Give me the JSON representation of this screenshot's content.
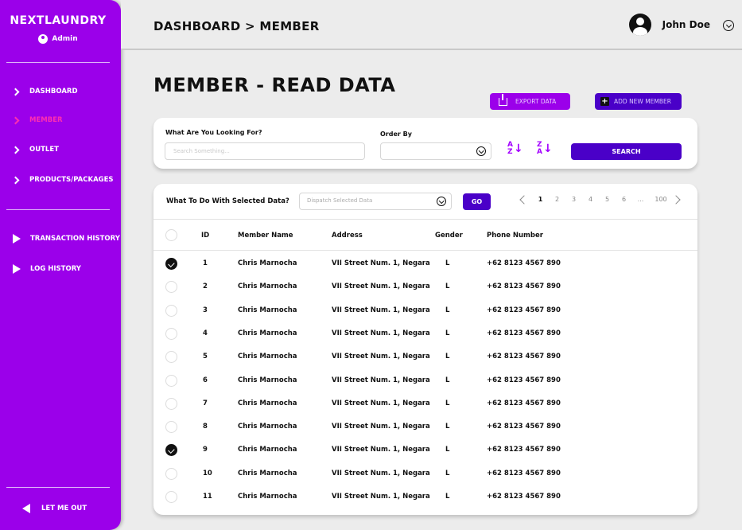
{
  "sidebar": {
    "brand": "NEXTLAUNDRY",
    "role": "Admin",
    "items": [
      {
        "label": "DASHBOARD"
      },
      {
        "label": "MEMBER"
      },
      {
        "label": "OUTLET"
      },
      {
        "label": "PRODUCTS/PACKAGES"
      }
    ],
    "history_items": [
      {
        "label": "TRANSACTION HISTORY"
      },
      {
        "label": "LOG HISTORY"
      }
    ],
    "logout": "LET ME OUT",
    "colors": {
      "background": "#9b00ea",
      "active": "#ff2fb0"
    }
  },
  "header": {
    "breadcrumb": "DASHBOARD > MEMBER",
    "user_name": "John Doe"
  },
  "main": {
    "title": "MEMBER - READ DATA",
    "export_label": "EXPORT DATA",
    "add_label": "ADD NEW MEMBER"
  },
  "search": {
    "label": "What Are You Looking For?",
    "placeholder": "Search Something...",
    "order_label": "Order By",
    "order_value": "",
    "sort_asc": {
      "top": "A",
      "bottom": "Z"
    },
    "sort_desc": {
      "top": "Z",
      "bottom": "A"
    },
    "button": "SEARCH"
  },
  "bulk": {
    "label": "What To Do With Selected Data?",
    "placeholder": "Dispatch Selected Data",
    "go": "GO"
  },
  "pagination": {
    "pages": [
      "1",
      "2",
      "3",
      "4",
      "5",
      "6",
      "...",
      "100"
    ],
    "current": "1"
  },
  "table": {
    "columns": [
      "ID",
      "Member Name",
      "Address",
      "Gender",
      "Phone Number"
    ],
    "rows": [
      {
        "checked": true,
        "id": "1",
        "name": "Chris Marnocha",
        "address": "VII Street Num. 1, Negara",
        "gender": "L",
        "phone": "+62 8123 4567 890"
      },
      {
        "checked": false,
        "id": "2",
        "name": "Chris Marnocha",
        "address": "VII Street Num. 1, Negara",
        "gender": "L",
        "phone": "+62 8123 4567 890"
      },
      {
        "checked": false,
        "id": "3",
        "name": "Chris Marnocha",
        "address": "VII Street Num. 1, Negara",
        "gender": "L",
        "phone": "+62 8123 4567 890"
      },
      {
        "checked": false,
        "id": "4",
        "name": "Chris Marnocha",
        "address": "VII Street Num. 1, Negara",
        "gender": "L",
        "phone": "+62 8123 4567 890"
      },
      {
        "checked": false,
        "id": "5",
        "name": "Chris Marnocha",
        "address": "VII Street Num. 1, Negara",
        "gender": "L",
        "phone": "+62 8123 4567 890"
      },
      {
        "checked": false,
        "id": "6",
        "name": "Chris Marnocha",
        "address": "VII Street Num. 1, Negara",
        "gender": "L",
        "phone": "+62 8123 4567 890"
      },
      {
        "checked": false,
        "id": "7",
        "name": "Chris Marnocha",
        "address": "VII Street Num. 1, Negara",
        "gender": "L",
        "phone": "+62 8123 4567 890"
      },
      {
        "checked": false,
        "id": "8",
        "name": "Chris Marnocha",
        "address": "VII Street Num. 1, Negara",
        "gender": "L",
        "phone": "+62 8123 4567 890"
      },
      {
        "checked": true,
        "id": "9",
        "name": "Chris Marnocha",
        "address": "VII Street Num. 1, Negara",
        "gender": "L",
        "phone": "+62 8123 4567 890"
      },
      {
        "checked": false,
        "id": "10",
        "name": "Chris Marnocha",
        "address": "VII Street Num. 1, Negara",
        "gender": "L",
        "phone": "+62 8123 4567 890"
      },
      {
        "checked": false,
        "id": "11",
        "name": "Chris Marnocha",
        "address": "VII Street Num. 1, Negara",
        "gender": "L",
        "phone": "+62 8123 4567 890"
      }
    ]
  },
  "icons": {
    "role": "user-shield-icon",
    "nav": "chevron-right-icon",
    "history": "play-icon",
    "logout": "back-arrow-icon",
    "avatar": "user-avatar-icon",
    "export": "upload-icon",
    "add": "plus-icon"
  },
  "accent_colors": {
    "primary": "#9b00ea",
    "secondary": "#4a00c8",
    "sort": "#a300ff"
  }
}
